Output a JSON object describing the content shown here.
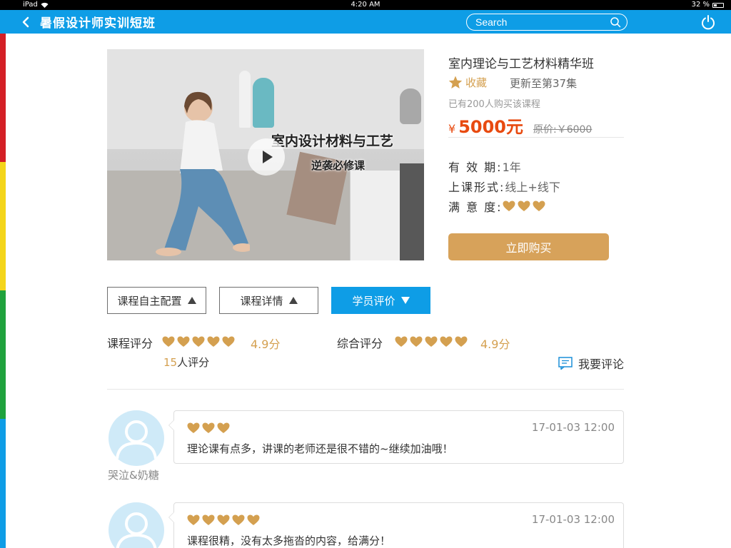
{
  "status_bar": {
    "device": "iPad",
    "time": "4:20 AM",
    "battery": "32 %"
  },
  "nav": {
    "back_icon": "chevron-left",
    "title": "暑假设计师实训短班",
    "search_placeholder": "Search",
    "power_icon": "power"
  },
  "stripe_colors": [
    "#d41f26",
    "#f4d51b",
    "#1fa23d",
    "#0e9de6"
  ],
  "colors": {
    "brand_blue": "#0e9de6",
    "gold": "#d4a050",
    "price_red": "#e84a10"
  },
  "video": {
    "overlay_line1": "室内设计材料与工艺",
    "overlay_line2": "逆袭必修课"
  },
  "course": {
    "title": "室内理论与工艺材料精华班",
    "favorite_label": "收藏",
    "update_text": "更新至第37集",
    "buyers_text": "已有200人购买该课程",
    "price_symbol": "¥",
    "price": "5000元",
    "original_price": "原价:￥6000",
    "validity_label": "有 效 期:",
    "validity_value": "1年",
    "mode_label": "上课形式:",
    "mode_value": "线上+线下",
    "satisfaction_label": "满 意 度:",
    "satisfaction_hearts": 3,
    "buy_button": "立即购买"
  },
  "tabs": [
    {
      "label": "课程自主配置",
      "active": false
    },
    {
      "label": "课程详情",
      "active": false
    },
    {
      "label": "学员评价",
      "active": true
    }
  ],
  "rating": {
    "course_label": "课程评分",
    "course_hearts": 5,
    "course_score": "4.9分",
    "overall_label": "综合评分",
    "overall_hearts": 5,
    "overall_score": "4.9分",
    "count_num": "15",
    "count_suffix": "人评分",
    "write_review": "我要评论"
  },
  "reviews": [
    {
      "username": "哭泣&奶糖",
      "hearts": 3,
      "time": "17-01-03  12:00",
      "text": "理论课有点多，讲课的老师还是很不错的~继续加油哦！"
    },
    {
      "username": "",
      "hearts": 5,
      "time": "17-01-03  12:00",
      "text": "课程很精，没有太多拖沓的内容，给满分！"
    }
  ]
}
